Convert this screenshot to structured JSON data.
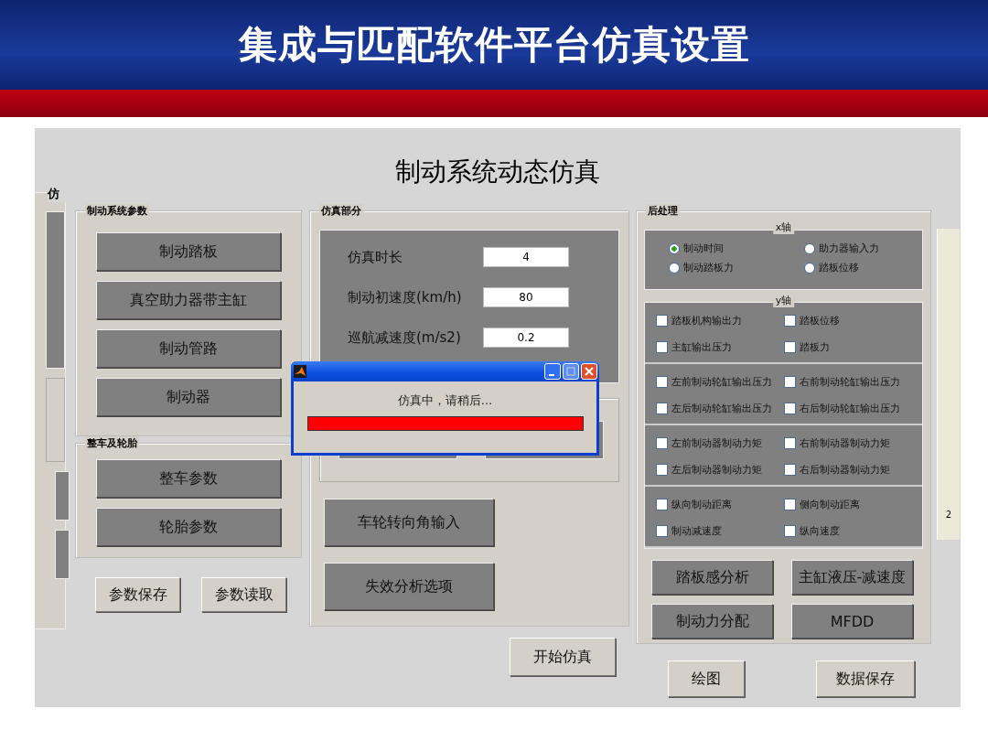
{
  "slide_title": "集成与匹配软件平台仿真设置",
  "gui": {
    "title": "制动系统动态仿真",
    "background_window": {
      "panel_label": "仿",
      "axis_tick": "2"
    },
    "brake_system_params": {
      "label": "制动系统参数",
      "buttons": [
        "制动踏板",
        "真空助力器带主缸",
        "制动管路",
        "制动器"
      ]
    },
    "vehicle_tire": {
      "label": "整车及轮胎",
      "buttons": [
        "整车参数",
        "轮胎参数"
      ]
    },
    "param_buttons": [
      "参数保存",
      "参数读取"
    ],
    "simulation": {
      "label": "仿真部分",
      "fields": [
        {
          "label": "仿真时长",
          "value": "4"
        },
        {
          "label": "制动初速度(km/h)",
          "value": "80"
        },
        {
          "label": "巡航减速度(m/s2)",
          "value": "0.2"
        }
      ],
      "buttons": [
        "车轮转向角输入",
        "失效分析选项"
      ],
      "start_button": "开始仿真"
    },
    "post_processing": {
      "label": "后处理",
      "x_axis": {
        "label": "x轴",
        "options": [
          {
            "label": "制动时间",
            "selected": true
          },
          {
            "label": "助力器输入力",
            "selected": false
          },
          {
            "label": "制动踏板力",
            "selected": false
          },
          {
            "label": "踏板位移",
            "selected": false
          }
        ]
      },
      "y_axis": {
        "label": "y轴",
        "groups": [
          [
            {
              "label": "踏板机构输出力",
              "checked": false
            },
            {
              "label": "踏板位移",
              "checked": false
            },
            {
              "label": "主缸输出压力",
              "checked": false
            },
            {
              "label": "踏板力",
              "checked": false
            }
          ],
          [
            {
              "label": "左前制动轮缸输出压力",
              "checked": false
            },
            {
              "label": "右前制动轮缸输出压力",
              "checked": false
            },
            {
              "label": "左后制动轮缸输出压力",
              "checked": false
            },
            {
              "label": "右后制动轮缸输出压力",
              "checked": false
            }
          ],
          [
            {
              "label": "左前制动器制动力矩",
              "checked": false
            },
            {
              "label": "右前制动器制动力矩",
              "checked": false
            },
            {
              "label": "左后制动器制动力矩",
              "checked": false
            },
            {
              "label": "右后制动器制动力矩",
              "checked": false
            }
          ],
          [
            {
              "label": "纵向制动距离",
              "checked": false
            },
            {
              "label": "侧向制动距离",
              "checked": false
            },
            {
              "label": "制动减速度",
              "checked": false
            },
            {
              "label": "纵向速度",
              "checked": false
            }
          ]
        ]
      },
      "buttons": [
        "踏板感分析",
        "主缸液压-减速度",
        "制动力分配",
        "MFDD"
      ],
      "bottom_buttons": [
        "绘图",
        "数据保存"
      ]
    },
    "progress_dialog": {
      "message": "仿真中，请稍后...",
      "level": 1
    }
  }
}
